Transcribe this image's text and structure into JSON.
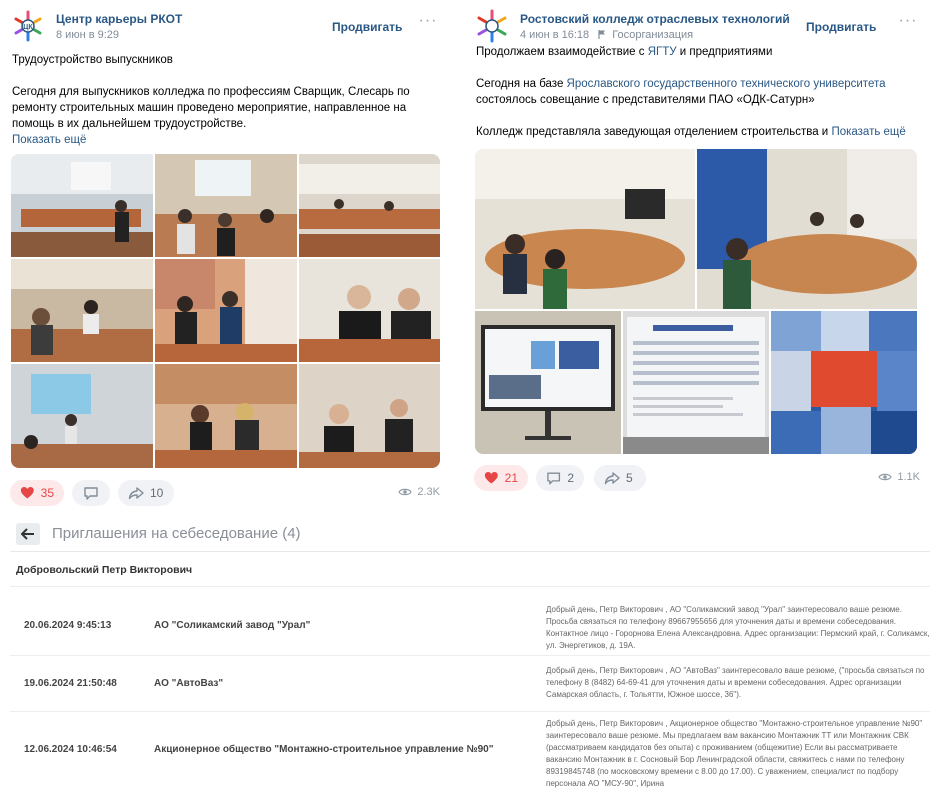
{
  "post_left": {
    "author": "Центр карьеры РКОТ",
    "date": "8 июн в 9:29",
    "promote": "Продвигать",
    "more": "···",
    "text_title": "Трудоустройство выпускников",
    "text_body": "Сегодня для выпускников колледжа по профессиям Сварщик, Слесарь по ремонту строительных машин проведено мероприятие, направленное на помощь в их дальнейшем трудоустройстве.",
    "show_more": "Показать ещё",
    "likes": "35",
    "comments": "",
    "shares": "10",
    "views": "2.3K"
  },
  "post_right": {
    "author": "Ростовский колледж отраслевых технологий",
    "date": "4 июн в 16:18",
    "org_type": "Госорганизация",
    "promote": "Продвигать",
    "more": "···",
    "line1_prefix": "Продолжаем взаимодействие с ",
    "line1_link": "ЯГТУ",
    "line1_suffix": " и предприятиями",
    "line2_prefix": "Сегодня на базе ",
    "line2_link": "Ярославского государственного технического университета",
    "line2_suffix": " состоялось совещание с представителями ПАО «ОДК-Сатурн»",
    "line3": "Колледж представляла заведующая отделением строительства и",
    "show_more": "Показать ещё",
    "likes": "21",
    "comments": "2",
    "shares": "5",
    "views": "1.1K",
    "booklet_text": "ПАО «ОДК-САТУРН» — ЭТО СТАБИЛЬНОСТЬ И ВЕЛИКИЕ ВОЗМОЖНОСТИ"
  },
  "invitations": {
    "title": "Приглашения на себеседование (4)",
    "person": "Добровольский Петр Викторович",
    "rows": [
      {
        "date": "20.06.2024 9:45:13",
        "org": "АО \"Соликамский завод \"Урал\"",
        "msg": "Добрый день, Петр Викторович , АО \"Соликамский завод \"Урал\" заинтересовало ваше резюме. Просьба связаться по телефону 89667955656 для уточнения даты и времени собеседования. Контактное лицо - Горорнова Елена Александровна. Адрес организации: Пермский край, г. Соликамск, ул. Энергетиков, д. 19А."
      },
      {
        "date": "19.06.2024 21:50:48",
        "org": "АО \"АвтоВаз\"",
        "msg": "Добрый день, Петр Викторович , АО \"АвтоВаз\" заинтересовало ваше резюме, (\"просьба связаться по телефону 8 (8482) 64-69-41 для уточнения даты и времени собеседования. Адрес организации Самарская область, г. Тольятти, Южное шоссе, 36\")."
      },
      {
        "date": "12.06.2024 10:46:54",
        "org": "Акционерное общество \"Монтажно-строительное управление №90\"",
        "msg": "Добрый день, Петр Викторович , Акционерное общество \"Монтажно-строительное управление №90\" заинтересовало ваше резюме. Мы предлагаем вам вакансию Монтажник ТТ или Монтажник СВК (рассматриваем кандидатов без опыта) с проживанием (общежитие) Если вы рассматриваете вакансию Монтажник в г. Сосновый Бор Ленинградской области, свяжитесь с нами по телефону 89319845748 (по московскому времени с 8.00 до 17.00). С уважением, специалист по подбору персонала АО \"МСУ-90\", Ирина"
      }
    ]
  },
  "colors": {
    "link": "#2a5885",
    "like_red": "#e64646",
    "muted": "#818c99"
  }
}
